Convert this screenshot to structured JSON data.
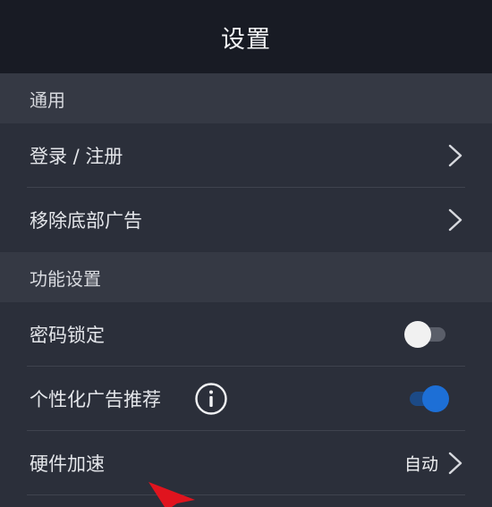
{
  "header": {
    "title": "设置"
  },
  "sections": {
    "general": {
      "title": "通用",
      "items": {
        "login": {
          "label": "登录 / 注册",
          "icon": "chevron-right-icon"
        },
        "remove_ads": {
          "label": "移除底部广告",
          "icon": "chevron-right-icon"
        }
      }
    },
    "features": {
      "title": "功能设置",
      "items": {
        "password_lock": {
          "label": "密码锁定",
          "toggle": "off"
        },
        "personalized_ads": {
          "label": "个性化广告推荐",
          "toggle": "on",
          "info_icon": "info-icon"
        },
        "hardware_accel": {
          "label": "硬件加速",
          "value": "自动",
          "icon": "chevron-right-icon"
        }
      }
    }
  },
  "colors": {
    "header_bg": "#181b24",
    "section_bg": "#353944",
    "row_bg": "#2b2f3a",
    "toggle_on": "#1d6fd6",
    "annotation_arrow": "#e0141e"
  }
}
